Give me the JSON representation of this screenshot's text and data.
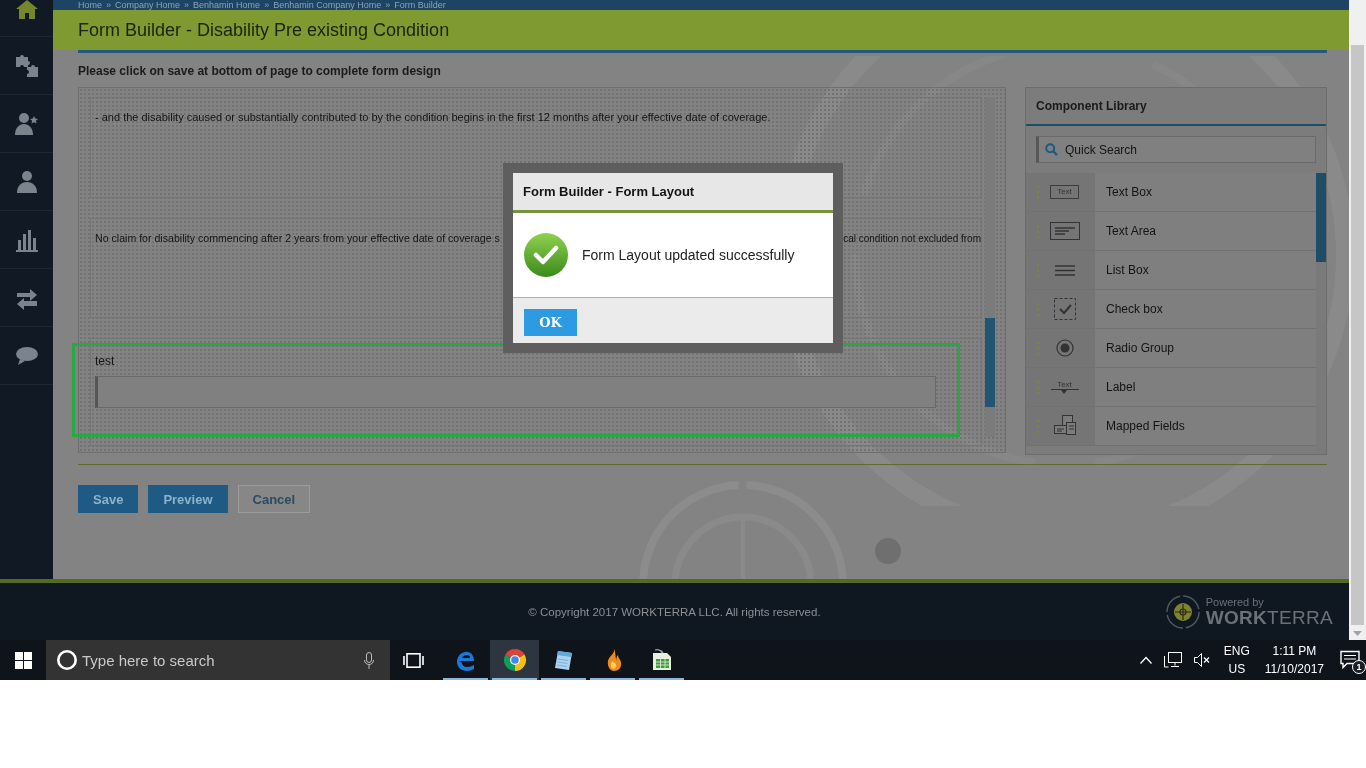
{
  "breadcrumb": {
    "items": [
      "Home",
      "Company Home",
      "Benhamin Home",
      "Benhamin Company Home",
      "Form Builder"
    ],
    "separator": "»"
  },
  "sidebar": {
    "items": [
      {
        "kind": "home",
        "selected": true
      },
      {
        "kind": "puzzle",
        "selected": false
      },
      {
        "kind": "user-star",
        "selected": false
      },
      {
        "kind": "user",
        "selected": false
      },
      {
        "kind": "chart",
        "selected": false
      },
      {
        "kind": "transfer",
        "selected": false
      },
      {
        "kind": "chat",
        "selected": false
      }
    ]
  },
  "page": {
    "title": "Form Builder - Disability Pre existing Condition",
    "instruction": "Please click on save at bottom of page to complete form design"
  },
  "canvas": {
    "panels": [
      {
        "kind": "paragraph",
        "text_parts": [
          "- and the disability caused or substantially contributed to by the condition begins in the first 12 months after your effective date of coverage."
        ]
      },
      {
        "kind": "paragraph",
        "text_parts": [
          "No claim for disability commencing after 2 years from your effective date of coverage s",
          "cal condition not excluded from"
        ]
      },
      {
        "kind": "field",
        "label": "test",
        "selected": true
      }
    ]
  },
  "component_library": {
    "title": "Component Library",
    "search": {
      "placeholder": "Quick Search"
    },
    "items": [
      {
        "kind": "textbox",
        "label": "Text Box",
        "icon_text": "Text"
      },
      {
        "kind": "textarea",
        "label": "Text Area"
      },
      {
        "kind": "listbox",
        "label": "List Box"
      },
      {
        "kind": "checkbox",
        "label": "Check box"
      },
      {
        "kind": "radio",
        "label": "Radio Group"
      },
      {
        "kind": "label",
        "label": "Label",
        "icon_text": "Text"
      },
      {
        "kind": "mapped",
        "label": "Mapped Fields"
      }
    ]
  },
  "buttons": [
    {
      "kind": "primary",
      "label": "Save"
    },
    {
      "kind": "primary",
      "label": "Preview"
    },
    {
      "kind": "secondary",
      "label": "Cancel"
    }
  ],
  "footer": {
    "copyright": "© Copyright 2017 WORKTERRA LLC. All rights reserved.",
    "powered_by": "Powered by",
    "brand": "**WORK**TERRA"
  },
  "dialog": {
    "title": "Form Builder - Form Layout",
    "message": "Form Layout updated successfully",
    "button": "OK"
  },
  "taskbar": {
    "search": {
      "placeholder": "Type here to search"
    },
    "apps": [
      {
        "kind": "edge",
        "selected": false,
        "running": true
      },
      {
        "kind": "chrome",
        "selected": true,
        "running": true
      },
      {
        "kind": "notepad",
        "selected": false,
        "running": true
      },
      {
        "kind": "flame",
        "selected": false,
        "running": true
      },
      {
        "kind": "spreadsheet",
        "selected": false,
        "running": true
      }
    ],
    "tray": {
      "language": "ENG",
      "region": "US",
      "time": "1:11 PM",
      "date": "11/10/2017",
      "notifications": "1"
    }
  }
}
